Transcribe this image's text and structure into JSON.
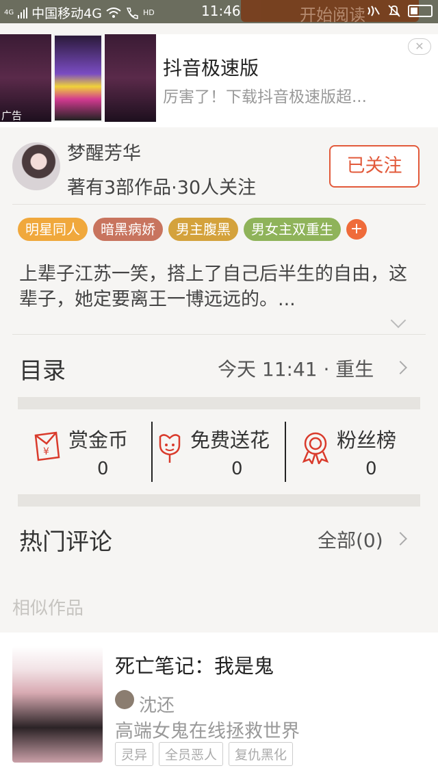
{
  "status_bar": {
    "network": "4G",
    "carrier": "中国移动4G",
    "hd": "HD",
    "time": "11:46",
    "bg_text": "开始阅读"
  },
  "ad": {
    "label": "广告",
    "title": "抖音极速版",
    "desc": "厉害了！下载抖音极速版超...",
    "close": "✕"
  },
  "author": {
    "name": "梦醒芳华",
    "stats": "著有3部作品·30人关注",
    "follow_label": "已关注"
  },
  "tags": [
    {
      "label": "明星同人",
      "color": "#f0a83c"
    },
    {
      "label": "暗黑病娇",
      "color": "#c8745e"
    },
    {
      "label": "男主腹黑",
      "color": "#d4a23c"
    },
    {
      "label": "男女主双重生",
      "color": "#8fb35a"
    }
  ],
  "tag_add": "+",
  "synopsis": "上辈子江苏一笑，搭上了自己后半生的自由，这辈子，她定要离王一博远远的。...",
  "catalog": {
    "title": "目录",
    "latest": "今天 11:41 · 重生"
  },
  "actions": [
    {
      "label": "赏金币",
      "value": "0",
      "icon": "red-envelope-icon"
    },
    {
      "label": "免费送花",
      "value": "0",
      "icon": "flower-icon"
    },
    {
      "label": "粉丝榜",
      "value": "0",
      "icon": "medal-icon"
    }
  ],
  "comments": {
    "title": "热门评论",
    "all_label": "全部(0)"
  },
  "similar": {
    "heading": "相似作品",
    "books": [
      {
        "title": "死亡笔记：我是鬼",
        "author": "沈还",
        "desc": "高端女鬼在线拯救世界",
        "tags": [
          "灵异",
          "全员恶人",
          "复仇黑化"
        ]
      }
    ]
  },
  "colors": {
    "accent": "#e2593a",
    "icon_red": "#d93a2b"
  }
}
